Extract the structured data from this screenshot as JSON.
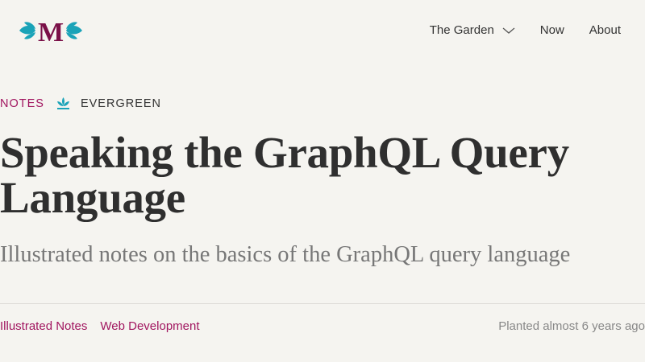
{
  "header": {
    "logo_letter": "M",
    "nav": [
      {
        "label": "The Garden",
        "has_dropdown": true
      },
      {
        "label": "Now"
      },
      {
        "label": "About"
      }
    ]
  },
  "post": {
    "category": "NOTES",
    "growth_stage": "EVERGREEN",
    "title": "Speaking the GraphQL Query Language",
    "subtitle": "Illustrated notes on the basics of the GraphQL query language",
    "tags": [
      "Illustrated Notes",
      "Web Development"
    ],
    "planted": "Planted almost 6 years ago"
  },
  "colors": {
    "accent": "#a1155f",
    "leaf": "#1aa3b8",
    "background": "#f5f4f0"
  }
}
